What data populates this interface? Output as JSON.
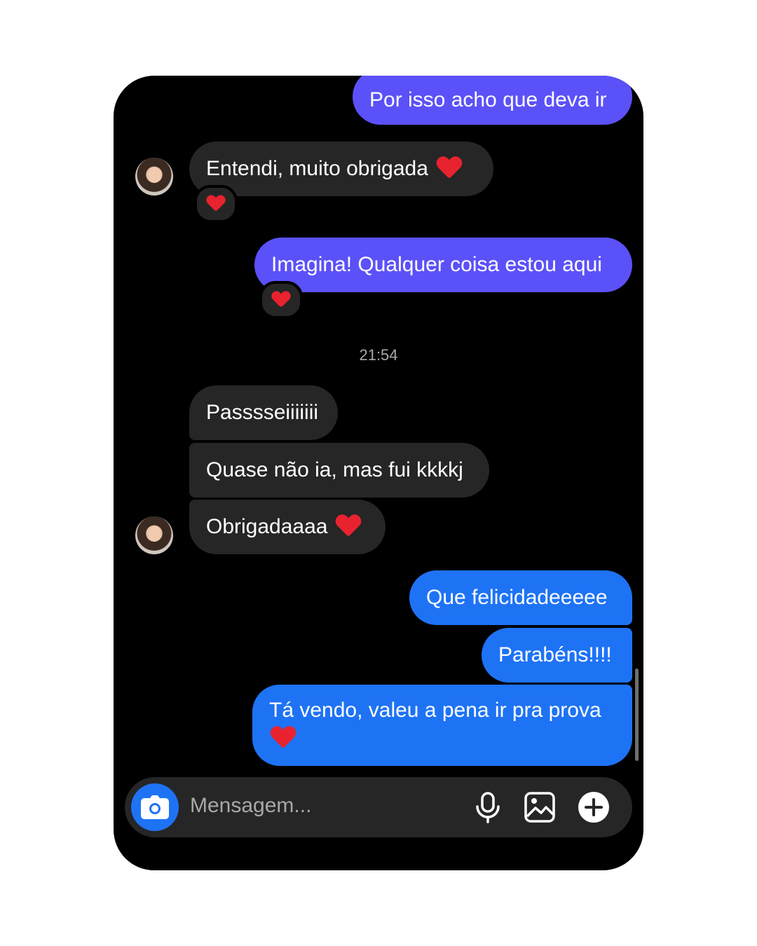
{
  "messages": [
    {
      "id": "m1",
      "direction": "outgoing",
      "text": "Por isso acho que deva ir"
    },
    {
      "id": "m2",
      "direction": "incoming",
      "text": "Entendi, muito obrigada",
      "emoji": "heart",
      "reaction": "heart"
    },
    {
      "id": "m3",
      "direction": "outgoing",
      "text": "Imagina! Qualquer coisa estou aqui",
      "reaction": "heart"
    },
    {
      "id": "m4",
      "direction": "incoming",
      "text": "Passsseiiiiiii"
    },
    {
      "id": "m5",
      "direction": "incoming",
      "text": "Quase não ia, mas fui kkkkj"
    },
    {
      "id": "m6",
      "direction": "incoming",
      "text": "Obrigadaaaa",
      "emoji": "heart"
    },
    {
      "id": "m7",
      "direction": "outgoing",
      "text": "Que felicidadeeeee"
    },
    {
      "id": "m8",
      "direction": "outgoing",
      "text": "Parabéns!!!!"
    },
    {
      "id": "m9",
      "direction": "outgoing",
      "text": "Tá vendo, valeu a pena ir pra prova",
      "emoji": "heart"
    }
  ],
  "timestamp": "21:54",
  "composer": {
    "placeholder": "Mensagem...",
    "icons": [
      "camera-icon",
      "microphone-icon",
      "gallery-icon",
      "plus-icon"
    ]
  },
  "colors": {
    "background": "#000000",
    "incoming_bubble": "#262626",
    "outgoing_bubble_old": "#5b51f8",
    "outgoing_bubble_new": "#1e73f5",
    "heart": "#e8232f",
    "muted_text": "#a8a8a8"
  }
}
